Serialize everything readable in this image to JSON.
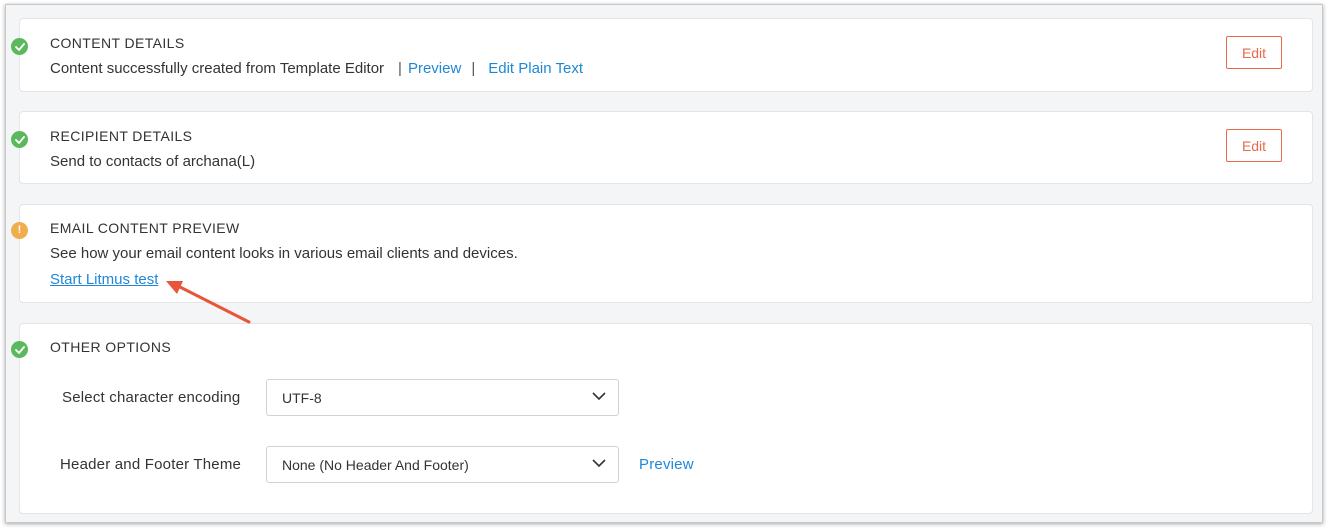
{
  "content_details": {
    "title": "CONTENT DETAILS",
    "description": "Content successfully created from Template Editor",
    "separator": "|",
    "preview_link": "Preview",
    "plain_text_link": "Edit Plain Text",
    "edit_button": "Edit",
    "status_icon": "check-circle-icon"
  },
  "recipient_details": {
    "title": "RECIPIENT DETAILS",
    "description": "Send to contacts of archana(L)",
    "edit_button": "Edit",
    "status_icon": "check-circle-icon"
  },
  "email_preview": {
    "title": "EMAIL CONTENT PREVIEW",
    "description": "See how your email content looks in various email clients and devices.",
    "litmus_link": "Start Litmus test",
    "status_icon": "warning-circle-icon",
    "status_glyph": "!"
  },
  "other_options": {
    "title": "OTHER OPTIONS",
    "status_icon": "check-circle-icon",
    "encoding_label": "Select character encoding",
    "encoding_value": "UTF-8",
    "theme_label": "Header and Footer Theme",
    "theme_value": "None (No Header And Footer)",
    "theme_preview_link": "Preview"
  },
  "colors": {
    "link": "#1e88d6",
    "edit_button": "#e86a4a",
    "success": "#5cb85c",
    "warning": "#f0ad4e",
    "annotation_arrow": "#e8553a"
  }
}
